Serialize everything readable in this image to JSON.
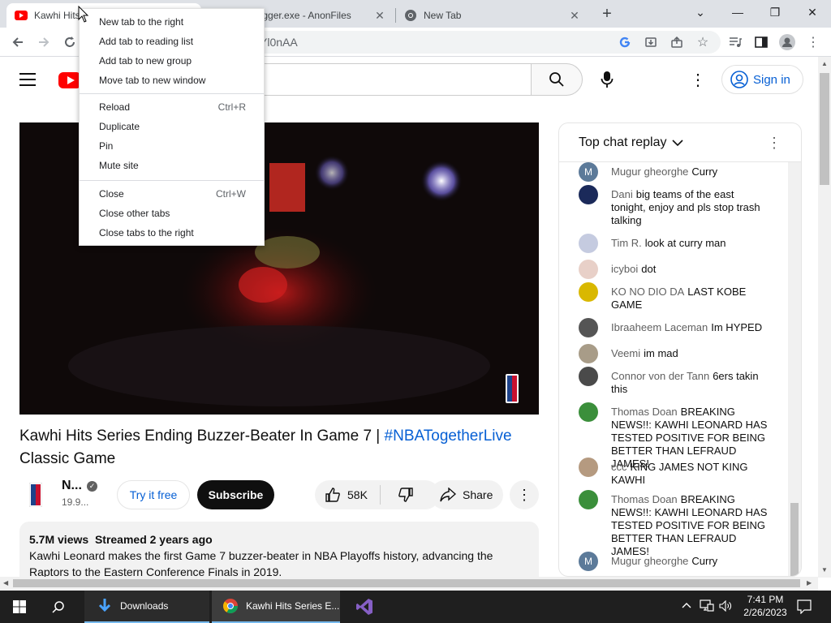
{
  "browser": {
    "tabs": [
      {
        "title": "Kawhi Hits Series Ending Buzzer-Beater In Game 7",
        "icon": "youtube-icon"
      },
      {
        "title": "Beat.Logger.exe - AnonFiles",
        "icon": "anonfiles-icon"
      },
      {
        "title": "New Tab",
        "icon": "chrome-icon"
      }
    ],
    "address_fragment": "Yl0nAA"
  },
  "context_menu": {
    "groups": [
      [
        {
          "label": "New tab to the right",
          "shortcut": ""
        },
        {
          "label": "Add tab to reading list",
          "shortcut": ""
        },
        {
          "label": "Add tab to new group",
          "shortcut": ""
        },
        {
          "label": "Move tab to new window",
          "shortcut": ""
        }
      ],
      [
        {
          "label": "Reload",
          "shortcut": "Ctrl+R"
        },
        {
          "label": "Duplicate",
          "shortcut": ""
        },
        {
          "label": "Pin",
          "shortcut": ""
        },
        {
          "label": "Mute site",
          "shortcut": ""
        }
      ],
      [
        {
          "label": "Close",
          "shortcut": "Ctrl+W"
        },
        {
          "label": "Close other tabs",
          "shortcut": ""
        },
        {
          "label": "Close tabs to the right",
          "shortcut": ""
        }
      ]
    ]
  },
  "youtube": {
    "sign_in": "Sign in",
    "video": {
      "title_main": "Kawhi Hits Series Ending Buzzer-Beater In Game 7 |",
      "title_hashtag": "#NBATogetherLive",
      "title_tail": "Classic Game",
      "channel_name": "N...",
      "channel_subs": "19.9...",
      "try_free": "Try it free",
      "subscribe": "Subscribe",
      "likes": "58K",
      "share": "Share",
      "views": "5.7M views",
      "streamed": "Streamed 2 years ago",
      "description": "Kawhi Leonard makes the first Game 7 buzzer-beater in NBA Playoffs history, advancing the Raptors to the Eastern Conference Finals in 2019."
    },
    "chat": {
      "header": "Top chat replay",
      "messages": [
        {
          "author": "Mugur gheorghe",
          "text": "Curry",
          "avatar": "M",
          "color": "#5c7a99"
        },
        {
          "author": "Dani",
          "text": "big teams of the east tonight, enjoy and pls stop trash talking",
          "avatar": "",
          "color": "#1b2a5a"
        },
        {
          "author": "Tim R.",
          "text": "look at curry man",
          "avatar": "",
          "color": "#c5cbe0"
        },
        {
          "author": "icyboi",
          "text": "dot",
          "avatar": "",
          "color": "#e8d0c8"
        },
        {
          "author": "KO NO DIO DA",
          "text": "LAST KOBE GAME",
          "avatar": "",
          "color": "#d9b800"
        },
        {
          "author": "Ibraaheem Laceman",
          "text": "Im HYPED",
          "avatar": "",
          "color": "#555555"
        },
        {
          "author": "Veemi",
          "text": "im mad",
          "avatar": "",
          "color": "#a89c88"
        },
        {
          "author": "Connor von der Tann",
          "text": "6ers takin this",
          "avatar": "",
          "color": "#4a4a4a"
        },
        {
          "author": "Thomas Doan",
          "text": "BREAKING NEWS!!: KAWHI LEONARD HAS TESTED POSITIVE FOR BEING BETTER THAN LEFRAUD JAMES!",
          "avatar": "",
          "color": "#3b8f3b"
        },
        {
          "author": "ccc",
          "text": "KING JAMES NOT KING KAWHI",
          "avatar": "",
          "color": "#b59a80"
        },
        {
          "author": "Thomas Doan",
          "text": "BREAKING NEWS!!: KAWHI LEONARD HAS TESTED POSITIVE FOR BEING BETTER THAN LEFRAUD JAMES!",
          "avatar": "",
          "color": "#3b8f3b"
        },
        {
          "author": "Mugur gheorghe",
          "text": "Curry",
          "avatar": "M",
          "color": "#5c7a99"
        }
      ]
    }
  },
  "taskbar": {
    "downloads": "Downloads",
    "chrome_window": "Kawhi Hits Series E...",
    "time": "7:41 PM",
    "date": "2/26/2023"
  }
}
